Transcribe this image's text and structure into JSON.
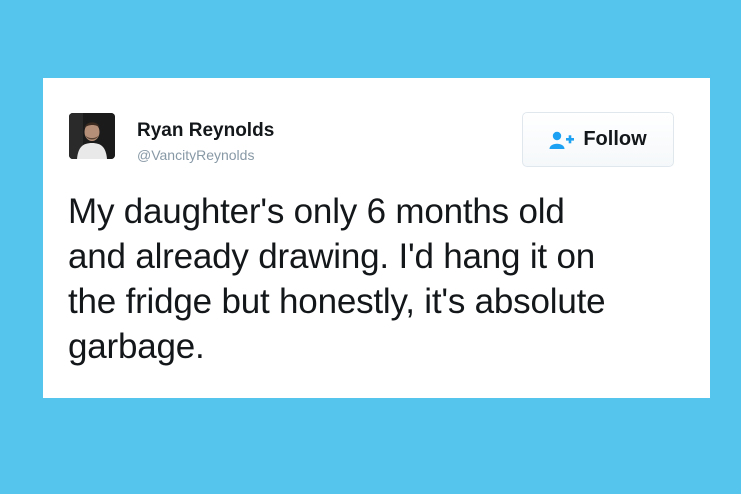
{
  "tweet": {
    "author": {
      "name": "Ryan Reynolds",
      "handle": "@VancityReynolds",
      "avatar_icon": "profile-photo"
    },
    "follow_button": {
      "label": "Follow",
      "icon": "add-user-icon",
      "icon_color": "#1da1f2"
    },
    "text_lines": [
      "My daughter's only 6 months old",
      "and already drawing. I'd hang it on",
      "the fridge but honestly, it's absolute",
      "garbage."
    ]
  },
  "colors": {
    "background": "#55c5ee",
    "card": "#ffffff",
    "text": "#14171a",
    "secondary_text": "#8899a6"
  }
}
